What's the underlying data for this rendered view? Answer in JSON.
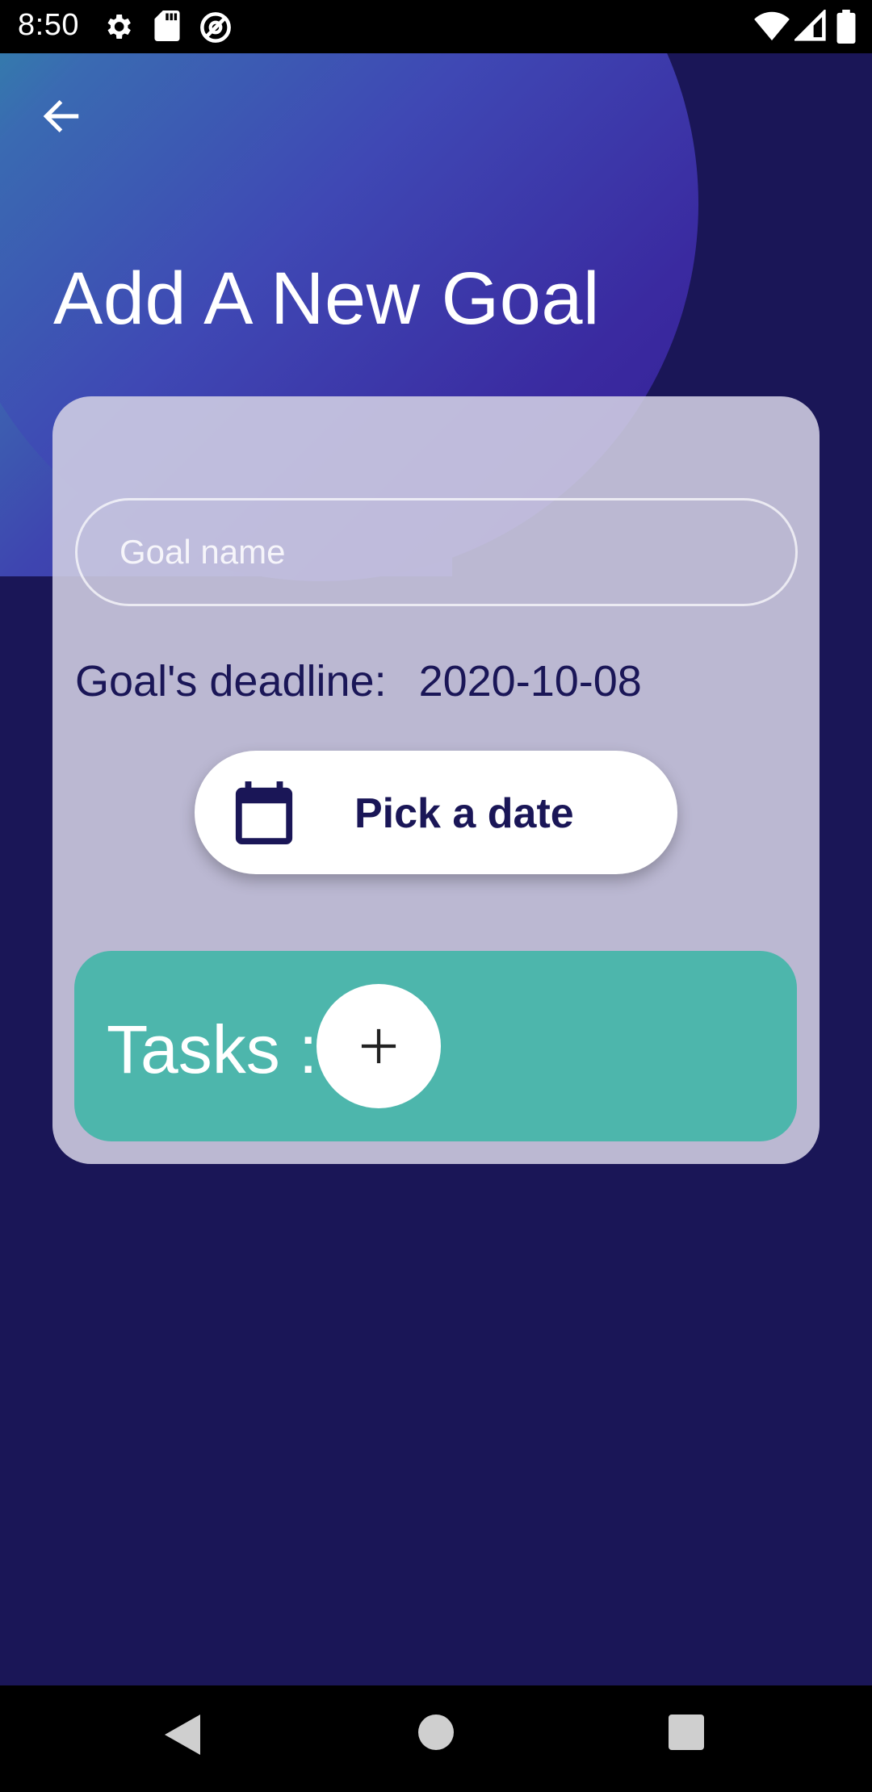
{
  "status_bar": {
    "time": "8:50",
    "left_icons": [
      "settings-icon",
      "sd-card-icon",
      "at-sign-icon"
    ],
    "right_icons": [
      "wifi-icon",
      "signal-icon",
      "battery-icon"
    ]
  },
  "header": {
    "back_icon": "arrow-left-icon",
    "title": "Add A New Goal"
  },
  "form": {
    "goal_name": {
      "value": "",
      "placeholder": "Goal name"
    },
    "deadline": {
      "label": "Goal's deadline:",
      "value": "2020-10-08"
    },
    "date_button": {
      "icon": "calendar-icon",
      "label": "Pick a date"
    },
    "tasks": {
      "label": "Tasks :",
      "add_icon": "plus-icon"
    }
  },
  "nav_bar": {
    "buttons": [
      "back-triangle-icon",
      "home-circle-icon",
      "recents-square-icon"
    ]
  },
  "colors": {
    "background": "#1a1657",
    "accent_teal": "#4db6ac",
    "card": "#d1cfe4",
    "text_dark": "#1a1657"
  }
}
